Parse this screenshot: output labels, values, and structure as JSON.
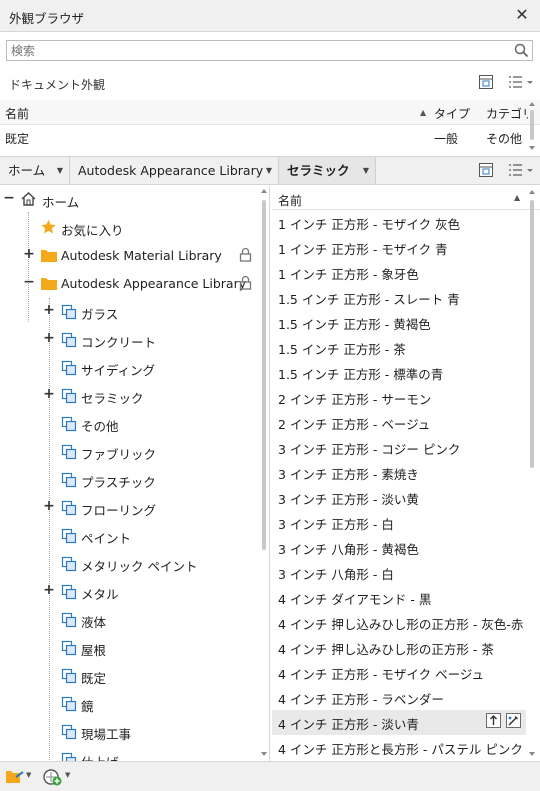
{
  "window": {
    "title": "外観ブラウザ"
  },
  "search": {
    "placeholder": "検索"
  },
  "document": {
    "label": "ドキュメント外観",
    "columns": {
      "name": "名前",
      "type": "タイプ",
      "category": "カテゴリ"
    },
    "rows": [
      {
        "name": "既定",
        "type": "一般",
        "category": "その他"
      }
    ]
  },
  "breadcrumb": [
    "ホーム",
    "Autodesk Appearance Library",
    "セラミック"
  ],
  "tree": {
    "home": "ホーム",
    "favorites": "お気に入り",
    "material_library": "Autodesk Material Library",
    "appearance_library": "Autodesk Appearance Library",
    "categories": [
      "ガラス",
      "コンクリート",
      "サイディング",
      "セラミック",
      "その他",
      "ファブリック",
      "プラスチック",
      "フローリング",
      "ペイント",
      "メタリック ペイント",
      "メタル",
      "液体",
      "屋根",
      "既定",
      "鏡",
      "現場工事",
      "仕上げ"
    ]
  },
  "list": {
    "column": "名前",
    "items": [
      "1 インチ 正方形 - モザイク 灰色",
      "1 インチ 正方形 - モザイク 青",
      "1 インチ 正方形 - 象牙色",
      "1.5 インチ 正方形 - スレート 青",
      "1.5 インチ 正方形 - 黄褐色",
      "1.5 インチ 正方形 - 茶",
      "1.5 インチ 正方形 - 標準の青",
      "2 インチ 正方形 - サーモン",
      "2 インチ 正方形 - ベージュ",
      "3 インチ 正方形 - コジー ピンク",
      "3 インチ 正方形 - 素焼き",
      "3 インチ 正方形 - 淡い黄",
      "3 インチ 正方形 - 白",
      "3 インチ 八角形 - 黄褐色",
      "3 インチ 八角形 - 白",
      "4 インチ ダイアモンド - 黒",
      "4 インチ 押し込みひし形の正方形 - 灰色-赤",
      "4 インチ 押し込みひし形の正方形 - 茶",
      "4 インチ 正方形 - モザイク ベージュ",
      "4 インチ 正方形 - ラベンダー",
      "4 インチ 正方形 - 淡い青",
      "4 インチ 正方形と長方形 - パステル ピンク"
    ],
    "selected_index": 20
  },
  "colors": {
    "folder": "#f5a81c",
    "star": "#f5a81c",
    "accent": "#2b78c5"
  }
}
